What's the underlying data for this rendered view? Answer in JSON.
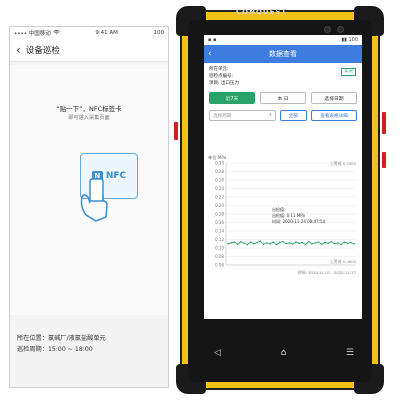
{
  "left_app": {
    "status": {
      "carrier": "•••• 中国移动",
      "wifi": "WiFi",
      "time": "9:41 AM",
      "battery": "100"
    },
    "nav": {
      "back": "‹",
      "title": "设备巡检"
    },
    "prompt": {
      "title": "“贴一下”，NFC标签卡",
      "subtitle": "即可进入采集页面"
    },
    "nfc_card": {
      "logo": "N",
      "label": "NFC"
    },
    "location": {
      "position_label": "所在位置：",
      "position": "氯碱厂/液氯盐酸单元",
      "period_label": "巡检周期：",
      "period": "15:00 ~ 18:00"
    }
  },
  "rugged_phone": {
    "brand": "CONQUEST",
    "screen": {
      "status": {
        "left": "▪ ▪",
        "right": "▮▮ 100"
      },
      "header": {
        "back": "‹",
        "title": "数据查看"
      },
      "info": {
        "line1": "所在单元:",
        "line2": "巡检点编号:",
        "line3": "项目: 出口压力",
        "status_badge": "实况"
      },
      "range_buttons": [
        {
          "label": "近7天",
          "active": true
        },
        {
          "label": "本 日",
          "active": false
        },
        {
          "label": "选择日期",
          "active": false
        }
      ],
      "select_placeholder": "选择周期",
      "btn_all": "全部",
      "btn_detail": "查看表格详细"
    }
  },
  "chart_data": {
    "type": "line",
    "ylabel": "单位:MPa",
    "y_ticks": [
      "0.30",
      "0.28",
      "0.26",
      "0.24",
      "0.22",
      "0.20",
      "0.18",
      "0.16",
      "0.14",
      "0.12",
      "0.10",
      "0.08",
      "0.06"
    ],
    "ylim": [
      0.06,
      0.3
    ],
    "upper_label": "上警戒 0.2300",
    "lower_label": "上警戒 0.0600",
    "tooltip": {
      "l1": "出检值:",
      "l2": "出检值: 0.11 MPa",
      "l3": "时间: 2020-11-24 08:47:54"
    },
    "time_range": "时间: 2020-11-01 - 2020-11-27",
    "series": [
      {
        "values": [
          0.11,
          0.112,
          0.114,
          0.109,
          0.115,
          0.111,
          0.108,
          0.114,
          0.11,
          0.113,
          0.116,
          0.109,
          0.112,
          0.11,
          0.114,
          0.108,
          0.113,
          0.115,
          0.11,
          0.112,
          0.109,
          0.114,
          0.111,
          0.113,
          0.108,
          0.115,
          0.11,
          0.112,
          0.114,
          0.109,
          0.113,
          0.111,
          0.115,
          0.11,
          0.112,
          0.108,
          0.114,
          0.111,
          0.113,
          0.11
        ]
      }
    ],
    "grid": true
  }
}
